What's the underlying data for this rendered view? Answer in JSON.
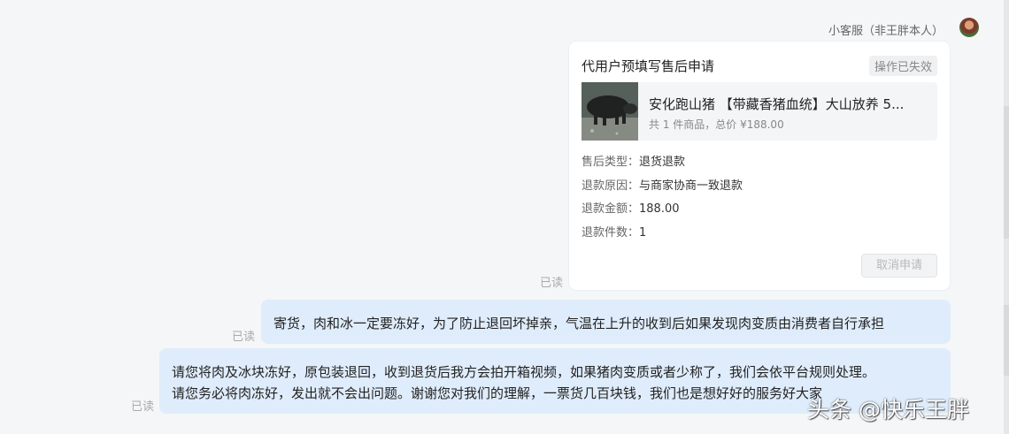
{
  "chat": {
    "sender_name": "小客服（非王胖本人）",
    "read_receipt": "已读"
  },
  "card": {
    "title": "代用户预填写售后申请",
    "status_badge": "操作已失效",
    "product": {
      "name": "安化跑山猪 【带藏香猪血统】大山放养 5...",
      "meta": "共 1 件商品，总价 ¥188.00"
    },
    "fields": [
      {
        "label": "售后类型：",
        "value": "退货退款"
      },
      {
        "label": "退款原因：",
        "value": "与商家协商一致退款"
      },
      {
        "label": "退款金额：",
        "value": "188.00"
      },
      {
        "label": "退款件数：",
        "value": "1"
      }
    ],
    "cancel_button": "取消申请"
  },
  "messages": [
    {
      "lines": [
        "寄货，肉和冰一定要冻好，为了防止退回坏掉亲，气温在上升的收到后如果发现肉变质由消费者自行承担"
      ]
    },
    {
      "lines": [
        "请您将肉及冰块冻好，原包装退回，收到退货后我方会拍开箱视频，如果猪肉变质或者少称了，我们会依平台规则处理。",
        "请您务必将肉冻好，发出就不会出问题。谢谢您对我们的理解，一票货几百块钱，我们也是想好好的服务好大家"
      ]
    }
  ],
  "watermark": "头条 @快乐王胖"
}
